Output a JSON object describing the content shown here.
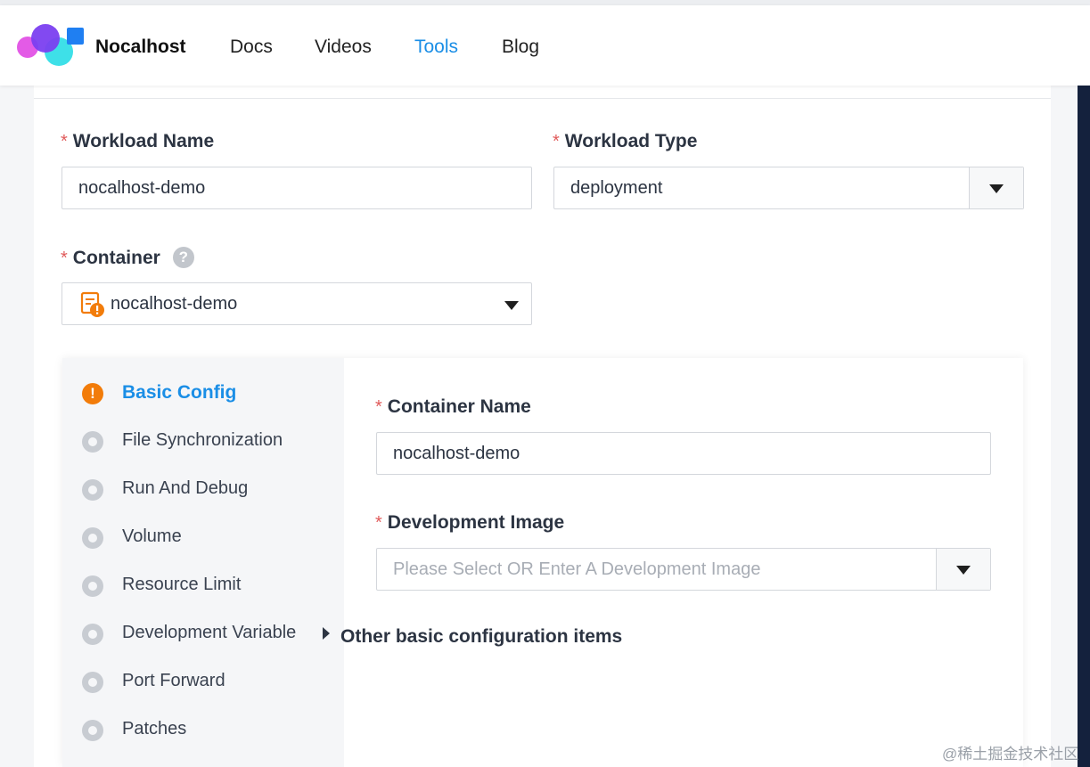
{
  "nav": {
    "brand": "Nocalhost",
    "links": [
      {
        "label": "Docs",
        "active": false
      },
      {
        "label": "Videos",
        "active": false
      },
      {
        "label": "Tools",
        "active": true
      },
      {
        "label": "Blog",
        "active": false
      }
    ],
    "active_color": "#1a8ee6"
  },
  "form": {
    "required_mark": "*",
    "workload_name": {
      "label": "Workload Name",
      "value": "nocalhost-demo"
    },
    "workload_type": {
      "label": "Workload Type",
      "value": "deployment"
    },
    "container": {
      "label": "Container",
      "help": "?",
      "value": "nocalhost-demo",
      "icon": "document-warning-icon"
    }
  },
  "sidebar": {
    "items": [
      {
        "label": "Basic Config",
        "status": "warning",
        "active": true
      },
      {
        "label": "File Synchronization",
        "status": "pending"
      },
      {
        "label": "Run And Debug",
        "status": "pending"
      },
      {
        "label": "Volume",
        "status": "pending"
      },
      {
        "label": "Resource Limit",
        "status": "pending"
      },
      {
        "label": "Development Variable",
        "status": "pending"
      },
      {
        "label": "Port Forward",
        "status": "pending"
      },
      {
        "label": "Patches",
        "status": "pending"
      }
    ],
    "warning_mark": "!"
  },
  "basic": {
    "container_name": {
      "label": "Container Name",
      "value": "nocalhost-demo"
    },
    "dev_image": {
      "label": "Development Image",
      "placeholder": "Please Select OR Enter A Development Image"
    },
    "other_items": "Other basic configuration items"
  },
  "watermark": "@稀土掘金技术社区"
}
